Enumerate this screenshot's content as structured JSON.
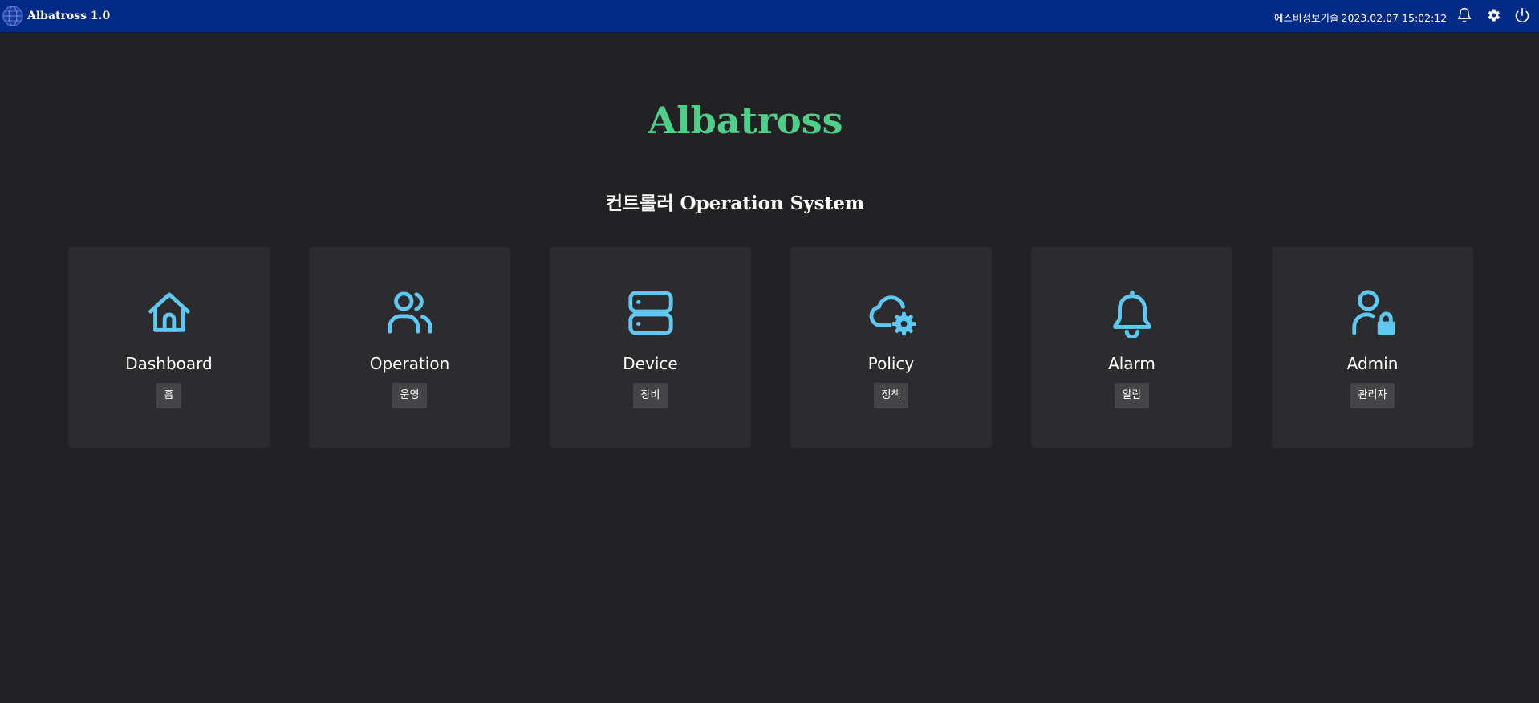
{
  "header": {
    "app_title": "Albatross 1.0",
    "company": "에스비정보기술",
    "datetime": "2023.02.07 15:02:12",
    "icons": [
      "bell-icon",
      "gear-icon",
      "power-icon"
    ]
  },
  "main": {
    "title": "Albatross",
    "subtitle": "컨트롤러 Operation System"
  },
  "colors": {
    "topbar": "#012986",
    "background": "#222224",
    "card": "#2c2c2e",
    "title": "#4fd08a",
    "icon": "#5ec8f2"
  },
  "cards": [
    {
      "title": "Dashboard",
      "badge": "홈",
      "icon": "home-icon"
    },
    {
      "title": "Operation",
      "badge": "운영",
      "icon": "users-icon"
    },
    {
      "title": "Device",
      "badge": "장비",
      "icon": "server-icon"
    },
    {
      "title": "Policy",
      "badge": "정책",
      "icon": "cloud-gear-icon"
    },
    {
      "title": "Alarm",
      "badge": "알람",
      "icon": "bell-icon"
    },
    {
      "title": "Admin",
      "badge": "관리자",
      "icon": "user-lock-icon"
    }
  ]
}
